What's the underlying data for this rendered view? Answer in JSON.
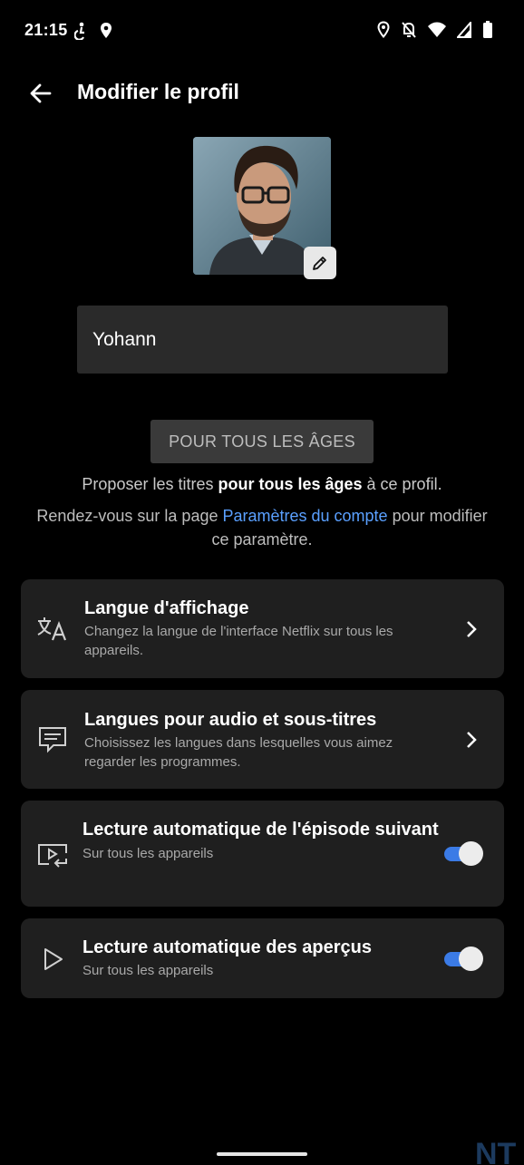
{
  "status_bar": {
    "time": "21:15",
    "left_icons": [
      "accessibility-icon",
      "location-pin-icon"
    ],
    "right_icons": [
      "location-icon",
      "notifications-off-icon",
      "wifi-icon",
      "signal-icon",
      "battery-icon"
    ]
  },
  "header": {
    "title": "Modifier le profil"
  },
  "profile": {
    "name_value": "Yohann"
  },
  "maturity": {
    "button_label": "POUR TOUS LES ÂGES",
    "desc_prefix": "Proposer les titres ",
    "desc_bold": "pour tous les âges",
    "desc_suffix": " à ce profil.",
    "note_prefix": "Rendez-vous sur la page ",
    "note_link": "Paramètres du compte",
    "note_suffix": " pour modifier ce paramètre."
  },
  "settings": [
    {
      "title": "Langue d'affichage",
      "subtitle": "Changez la langue de l'interface Netflix sur tous les appareils.",
      "icon": "translate-icon",
      "control": "chevron"
    },
    {
      "title": "Langues pour audio et sous-titres",
      "subtitle": "Choisissez les langues dans lesquelles vous aimez regarder les programmes.",
      "icon": "subtitles-icon",
      "control": "chevron"
    },
    {
      "title": "Lecture automatique de l'épisode suivant",
      "subtitle": "Sur tous les appareils",
      "icon": "next-episode-icon",
      "control": "toggle",
      "enabled": true
    },
    {
      "title": "Lecture automatique des aperçus",
      "subtitle": "Sur tous les appareils",
      "icon": "play-icon",
      "control": "toggle",
      "enabled": true
    }
  ],
  "colors": {
    "background": "#000000",
    "card": "#1f1f1f",
    "link": "#5aa0ff",
    "toggle_on": "#3b7be6"
  },
  "watermark": "NT"
}
